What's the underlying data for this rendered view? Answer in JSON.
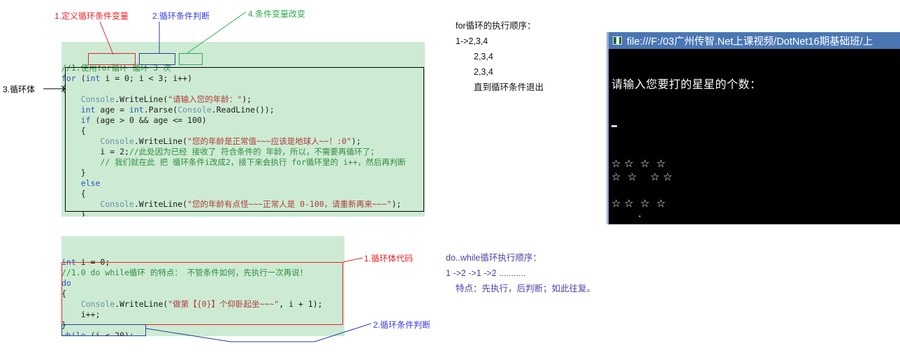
{
  "annotations": {
    "top": [
      {
        "id": "a1",
        "text": "1.定义循环条件变量",
        "color": "red"
      },
      {
        "id": "a2",
        "text": "2.循环条件判断",
        "color": "blue"
      },
      {
        "id": "a4",
        "text": "4.条件变量改变",
        "color": "green"
      },
      {
        "id": "a3",
        "text": "3.循环体",
        "color": "black"
      }
    ],
    "bottom": [
      {
        "id": "b1",
        "text": "1.循环体代码",
        "color": "red"
      },
      {
        "id": "b2",
        "text": "2.循环条件判断",
        "color": "blue"
      }
    ]
  },
  "for_code": {
    "lines": [
      {
        "segs": [
          {
            "t": "//1.使用for循环 循环 3 次",
            "c": "cmt"
          }
        ]
      },
      {
        "segs": [
          {
            "t": "for ",
            "c": "kw"
          },
          {
            "t": "(",
            "c": "plain"
          },
          {
            "t": "int",
            "c": "kw"
          },
          {
            "t": " i = ",
            "c": "plain"
          },
          {
            "t": "0",
            "c": "plain"
          },
          {
            "t": "; i < 3; i++)",
            "c": "plain"
          }
        ]
      },
      {
        "segs": [
          {
            "t": "{",
            "c": "plain"
          }
        ]
      },
      {
        "segs": [
          {
            "t": "    ",
            "c": "plain"
          },
          {
            "t": "Console",
            "c": "cls"
          },
          {
            "t": ".WriteLine(",
            "c": "plain"
          },
          {
            "t": "\"请输入您的年龄：\"",
            "c": "str"
          },
          {
            "t": ");",
            "c": "plain"
          }
        ]
      },
      {
        "segs": [
          {
            "t": "    ",
            "c": "plain"
          },
          {
            "t": "int",
            "c": "kw"
          },
          {
            "t": " age = ",
            "c": "plain"
          },
          {
            "t": "int",
            "c": "kw"
          },
          {
            "t": ".Parse(",
            "c": "plain"
          },
          {
            "t": "Console",
            "c": "cls"
          },
          {
            "t": ".ReadLine());",
            "c": "plain"
          }
        ]
      },
      {
        "segs": [
          {
            "t": "    ",
            "c": "plain"
          },
          {
            "t": "if",
            "c": "kw"
          },
          {
            "t": " (age > 0 && age <= 100)",
            "c": "plain"
          }
        ]
      },
      {
        "segs": [
          {
            "t": "    {",
            "c": "plain"
          }
        ]
      },
      {
        "segs": [
          {
            "t": "        ",
            "c": "plain"
          },
          {
            "t": "Console",
            "c": "cls"
          },
          {
            "t": ".WriteLine(",
            "c": "plain"
          },
          {
            "t": "\"您的年龄是正常值~~~应该是地球人~~！:0\"",
            "c": "str"
          },
          {
            "t": ");",
            "c": "plain"
          }
        ]
      },
      {
        "segs": [
          {
            "t": "        i = 2;",
            "c": "plain"
          },
          {
            "t": "//此处因为已经 接收了 符合条件的 年龄，所以，不需要再循环了；",
            "c": "cmt"
          }
        ]
      },
      {
        "segs": [
          {
            "t": "        ",
            "c": "plain"
          },
          {
            "t": "// 我们就在此 把 循环条件i改成2，接下来会执行 for循环里的 i++，然后再判断",
            "c": "cmt"
          }
        ]
      },
      {
        "segs": [
          {
            "t": "    }",
            "c": "plain"
          }
        ]
      },
      {
        "segs": [
          {
            "t": "    ",
            "c": "plain"
          },
          {
            "t": "else",
            "c": "kw"
          }
        ]
      },
      {
        "segs": [
          {
            "t": "    {",
            "c": "plain"
          }
        ]
      },
      {
        "segs": [
          {
            "t": "        ",
            "c": "plain"
          },
          {
            "t": "Console",
            "c": "cls"
          },
          {
            "t": ".WriteLine(",
            "c": "plain"
          },
          {
            "t": "\"您的年龄有点怪~~~正常人是 0-100，请重新再来~~~\"",
            "c": "str"
          },
          {
            "t": ");",
            "c": "plain"
          }
        ]
      },
      {
        "segs": [
          {
            "t": "    }",
            "c": "plain"
          }
        ]
      },
      {
        "segs": [
          {
            "t": "}",
            "c": "plain"
          }
        ]
      }
    ]
  },
  "dowhile_code": {
    "lines": [
      {
        "segs": [
          {
            "t": "int",
            "c": "kw"
          },
          {
            "t": " i = ",
            "c": "plain"
          },
          {
            "t": "0",
            "c": "plain"
          },
          {
            "t": ";",
            "c": "plain"
          }
        ]
      },
      {
        "segs": [
          {
            "t": "//1.0 do while循环 的特点： 不管条件如何，先执行一次再说！",
            "c": "cmt"
          }
        ]
      },
      {
        "segs": [
          {
            "t": "do",
            "c": "kw"
          }
        ]
      },
      {
        "segs": [
          {
            "t": "{",
            "c": "plain"
          }
        ]
      },
      {
        "segs": [
          {
            "t": "    ",
            "c": "plain"
          },
          {
            "t": "Console",
            "c": "cls"
          },
          {
            "t": ".WriteLine(",
            "c": "plain"
          },
          {
            "t": "\"做第【{0}】个仰卧起坐~~~\"",
            "c": "str"
          },
          {
            "t": ", i + 1);",
            "c": "plain"
          }
        ]
      },
      {
        "segs": [
          {
            "t": "    i++;",
            "c": "plain"
          }
        ]
      },
      {
        "segs": [
          {
            "t": "}",
            "c": "plain"
          }
        ]
      },
      {
        "segs": [
          {
            "t": "while",
            "c": "kw"
          },
          {
            "t": " (i < 20);",
            "c": "plain"
          }
        ]
      }
    ]
  },
  "notes": {
    "for_order": {
      "title": "for循环的执行顺序：",
      "lines": [
        "1->2,3,4",
        "2,3,4",
        "2,3,4",
        "直到循环条件退出"
      ]
    },
    "dowhile_order": {
      "title": "do..while循环执行顺序：",
      "lines": [
        "1 ->2 ->1 ->2   ...........",
        "特点：先执行，后判断；如此往复。"
      ]
    }
  },
  "console": {
    "title": "file:///F:/03广州传智.Net上课视频/DotNet16期基础班/上",
    "icon": "console-app-icon",
    "prompt": "请输入您要打的星星的个数：",
    "star_lines": [
      "☆ ☆  ☆  ☆",
      "☆  ☆    ☆ ☆",
      "",
      "☆ ☆  ☆  ☆",
      "        ·"
    ]
  },
  "colors": {
    "accent_red": "#e8232a",
    "accent_blue": "#3b3ddb",
    "accent_green": "#2fa84f",
    "code_bg": "#cdebd3",
    "title_bar": "#4a77b4",
    "console_bg": "#000000"
  }
}
